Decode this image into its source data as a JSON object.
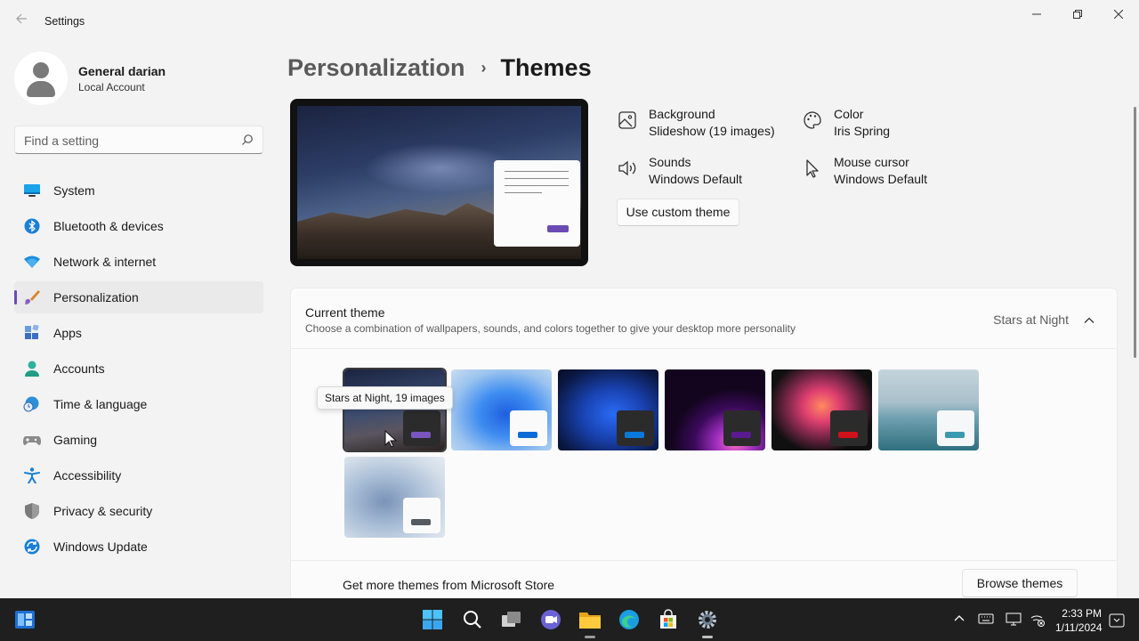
{
  "window": {
    "title": "Settings"
  },
  "profile": {
    "name": "General darian",
    "account_type": "Local Account"
  },
  "search": {
    "placeholder": "Find a setting"
  },
  "nav": [
    {
      "label": "System",
      "icon": "monitor-icon"
    },
    {
      "label": "Bluetooth & devices",
      "icon": "bluetooth-icon"
    },
    {
      "label": "Network & internet",
      "icon": "wifi-icon"
    },
    {
      "label": "Personalization",
      "icon": "paintbrush-icon",
      "active": true
    },
    {
      "label": "Apps",
      "icon": "apps-icon"
    },
    {
      "label": "Accounts",
      "icon": "person-icon"
    },
    {
      "label": "Time & language",
      "icon": "globe-clock-icon"
    },
    {
      "label": "Gaming",
      "icon": "gamepad-icon"
    },
    {
      "label": "Accessibility",
      "icon": "accessibility-icon"
    },
    {
      "label": "Privacy & security",
      "icon": "shield-icon"
    },
    {
      "label": "Windows Update",
      "icon": "update-icon"
    }
  ],
  "breadcrumb": {
    "parent": "Personalization",
    "separator": "›",
    "current": "Themes"
  },
  "theme_info": {
    "background": {
      "label": "Background",
      "value": "Slideshow (19 images)",
      "icon": "picture-icon"
    },
    "color": {
      "label": "Color",
      "value": "Iris Spring",
      "icon": "palette-icon"
    },
    "sounds": {
      "label": "Sounds",
      "value": "Windows Default",
      "icon": "speaker-icon"
    },
    "cursor": {
      "label": "Mouse cursor",
      "value": "Windows Default",
      "icon": "cursor-icon"
    },
    "custom_button": "Use custom theme"
  },
  "current_theme": {
    "title": "Current theme",
    "description": "Choose a combination of wallpapers, sounds, and colors together to give your desktop more personality",
    "selected": "Stars at Night",
    "tooltip": "Stars at Night, 19 images"
  },
  "store": {
    "text": "Get more themes from Microsoft Store",
    "button": "Browse themes"
  },
  "taskbar": {
    "time": "2:33 PM",
    "date": "1/11/2024"
  },
  "colors": {
    "accent": "#6b4bb3",
    "sidebar_active": "#eaeaea",
    "taskbar": "#1f1f1f"
  }
}
